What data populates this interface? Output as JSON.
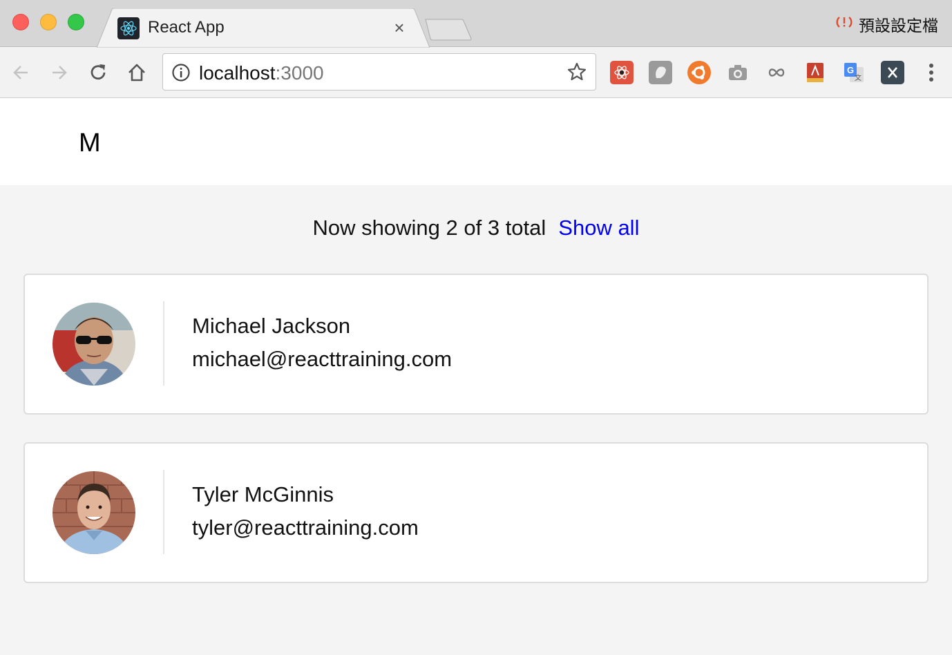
{
  "browser": {
    "tab_title": "React App",
    "tab_close": "×",
    "profile_label": "預設設定檔",
    "profile_icon": "sync-error-icon",
    "url_host": "localhost",
    "url_port": ":3000",
    "extensions": [
      "react-devtools",
      "ghostery",
      "ubuntu-ext",
      "screenshot-camera",
      "infinity-link",
      "pdf-reader",
      "google-translate",
      "x-extension"
    ]
  },
  "app": {
    "logo": "M",
    "summary": {
      "text": "Now showing 2 of 3 total",
      "link": "Show all"
    },
    "contacts": [
      {
        "name": "Michael Jackson",
        "email": "michael@reacttraining.com"
      },
      {
        "name": "Tyler McGinnis",
        "email": "tyler@reacttraining.com"
      }
    ]
  },
  "colors": {
    "link": "#0000ee",
    "page_bg": "#f4f4f4",
    "card_border": "#dcdcdc"
  }
}
